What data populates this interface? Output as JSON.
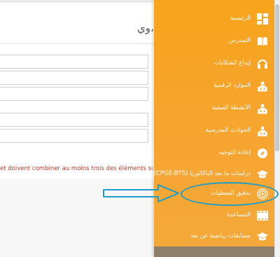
{
  "background_page": {
    "title_fragment": "وي،",
    "error_text": "et doivent combiner au moins trois des éléments suivants : le"
  },
  "sidebar": {
    "items": [
      {
        "label": "الرئيسية",
        "icon": "dashboard-icon"
      },
      {
        "label": "التمدرس",
        "icon": "book-icon"
      },
      {
        "label": "إيداع الشكايات",
        "icon": "headset-icon"
      },
      {
        "label": "الموارد الرقمية",
        "icon": "group-icon"
      },
      {
        "label": "الأنشطة الصفية",
        "icon": "group-icon"
      },
      {
        "label": "الحوادث المدرسية",
        "icon": "group-icon"
      },
      {
        "label": "إعادة التوجيه",
        "icon": "compass-icon"
      },
      {
        "label": "دراسات ما بعد الباكالوريا (CPGE-BTS)",
        "icon": "graduation-cap-icon"
      },
      {
        "label": "تدقيق المعطيات",
        "icon": "target-icon"
      },
      {
        "label": "المساعدة",
        "icon": "film-icon"
      },
      {
        "label": "مسابقات رياضية عن بعد",
        "icon": "graduation-cap-icon"
      }
    ]
  },
  "colors": {
    "sidebar": "#f7a41d",
    "annotation": "#1a9ec9",
    "error": "#c0392b"
  }
}
